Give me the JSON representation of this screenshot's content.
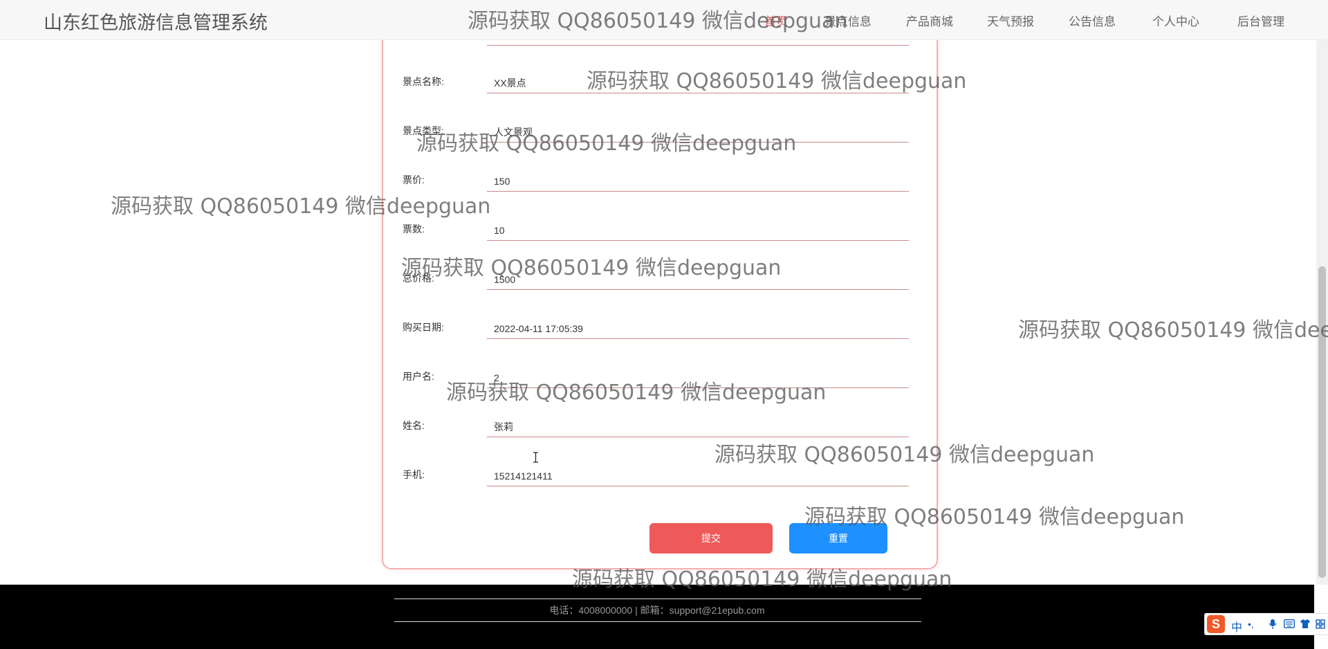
{
  "header": {
    "site_title": "山东红色旅游信息管理系统",
    "nav": [
      {
        "label": "首页",
        "active": true
      },
      {
        "label": "景点信息"
      },
      {
        "label": "产品商城"
      },
      {
        "label": "天气预报"
      },
      {
        "label": "公告信息"
      },
      {
        "label": "个人中心"
      },
      {
        "label": "后台管理"
      }
    ]
  },
  "form": {
    "fields": [
      {
        "label": "景点名称:",
        "value": "XX景点"
      },
      {
        "label": "景点类型:",
        "value": "人文景观"
      },
      {
        "label": "票价:",
        "value": "150"
      },
      {
        "label": "票数:",
        "value": "10"
      },
      {
        "label": "总价格:",
        "value": "1500"
      },
      {
        "label": "购买日期:",
        "value": "2022-04-11 17:05:39"
      },
      {
        "label": "用户名:",
        "value": "2"
      },
      {
        "label": "姓名:",
        "value": "张莉"
      },
      {
        "label": "手机:",
        "value": "15214121411"
      }
    ],
    "submit_label": "提交",
    "reset_label": "重置"
  },
  "footer": {
    "text": "电话：4008000000 | 邮箱：support@21epub.com"
  },
  "watermark": "源码获取 QQ86050149 微信deepguan",
  "ime": {
    "logo": "S",
    "mode": "中",
    "punct": "•,",
    "mic_icon": "mic-icon",
    "keyboard_icon": "keyboard-icon",
    "skin_icon": "shirt-icon",
    "grid_icon": "grid-icon"
  },
  "colors": {
    "accent": "#ee5a5a",
    "reset_button": "#1e90ff",
    "card_border": "#f3b0b0",
    "footer_bg": "#000000"
  }
}
